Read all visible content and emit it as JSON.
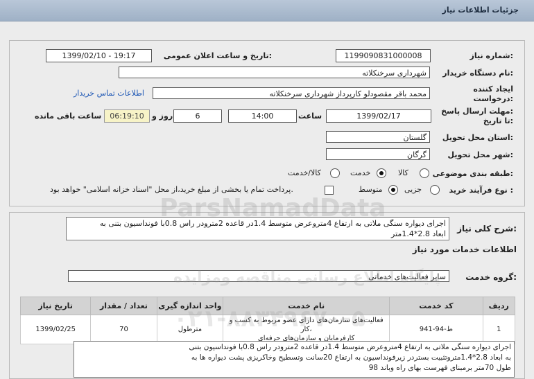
{
  "window": {
    "title": "جزئیات اطلاعات نیاز"
  },
  "form": {
    "need_number_label": "شماره نیاز:",
    "need_number": "1199090831000008",
    "announce_label": "تاریخ و ساعت اعلان عمومی:",
    "announce_value": "1399/02/10 - 19:17",
    "buyer_org_label": "نام دستگاه خریدار:",
    "buyer_org": "شهرداری سرخنکلاته",
    "creator_label_1": "ایجاد کننده",
    "creator_label_2": "درخواست:",
    "creator": "محمد باقر مقصودلو کارپرداز شهرداری سرخنکلاته",
    "contact_link": "اطلاعات تماس خریدار",
    "deadline_label_1": "مهلت ارسال پاسخ:",
    "deadline_label_2": "تا تاریخ:",
    "deadline_date": "1399/02/17",
    "time_label": "ساعت",
    "deadline_time": "14:00",
    "days_value": "6",
    "days_label": "روز و",
    "remaining_time": "06:19:10",
    "remaining_label": "ساعت باقی مانده",
    "province_label": "استان محل تحویل:",
    "province": "گلستان",
    "city_label": "شهر محل تحویل:",
    "city": "گرگان",
    "category_label": "طبقه بندی موضوعی:",
    "category_options": [
      "کالا",
      "خدمت",
      "کالا/خدمت"
    ],
    "process_label": "نوع فرآیند خرید :",
    "process_options": [
      "جزیی",
      "متوسط"
    ],
    "payment_text": "پرداخت تمام یا بخشی از مبلغ خرید،از محل \"اسناد خزانه اسلامی\" خواهد بود."
  },
  "summary": {
    "label": "شرح کلی نیاز:",
    "text_line1": "اجرای دیواره سنگی ملاتی به ارتفاع 4متروعرض متوسط 1.4در قاعده 2مترودر راس 0.8با فونداسیون بتنی به",
    "text_line2": "ابعاد 2.8*1.4متر"
  },
  "services": {
    "section_title": "اطلاعات خدمات مورد نیاز",
    "group_label": "گروه خدمت:",
    "group_value": "سایر فعالیت‌های خدماتی",
    "columns": [
      "ردیف",
      "کد خدمت",
      "نام خدمت",
      "واحد اندازه گیری",
      "تعداد / مقدار",
      "تاریخ نیاز"
    ],
    "rows": [
      {
        "row": "1",
        "code": "ط-94-941",
        "name_line1": "فعالیت‌های سازمان‌های دارای عضو مربوط به کسب و کار،",
        "name_line2": "کارفرمایان و سازمان‌های حرفه‌ای",
        "unit": "مترطول",
        "qty": "70",
        "date": "1399/02/25"
      }
    ]
  },
  "detail": {
    "line1": "اجرای دیواره سنگی ملاتی به ارتفاع 4متروعرض متوسط 1.4در قاعده 2مترودر راس 0.8با فونداسیون بتنی",
    "line2": "به ابعاد 2.8*1.4متروتثبیت بستردر زیرفونداسیون به ارتفاع 20سانت وتسطیح وخاکریزی پشت دیواره ها به",
    "line3": "طول 70متر برمبنای فهرست بهای راه وباند 98"
  },
  "watermark": {
    "brand": "ParsNamadData",
    "line_fa": "پایگاه اطلاع رسانی مناقصه ومزایده",
    "phone": "۰۲۱-۸۸۳۴۹۶۷۰-۵"
  }
}
